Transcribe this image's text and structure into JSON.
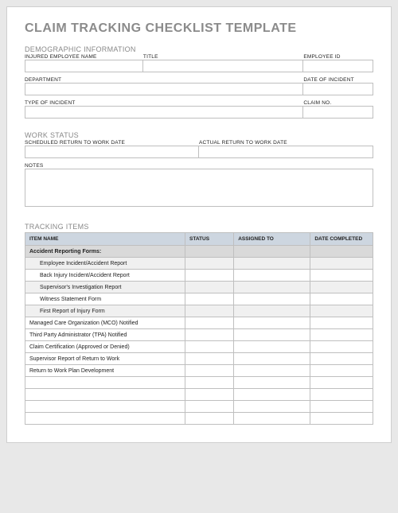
{
  "title": "CLAIM TRACKING CHECKLIST TEMPLATE",
  "sections": {
    "demographic": {
      "heading": "DEMOGRAPHIC INFORMATION",
      "labels": {
        "employee_name": "INJURED EMPLOYEE NAME",
        "title": "TITLE",
        "employee_id": "EMPLOYEE ID",
        "department": "DEPARTMENT",
        "date_of_incident": "DATE OF INCIDENT",
        "type_of_incident": "TYPE OF INCIDENT",
        "claim_no": "CLAIM NO."
      }
    },
    "work_status": {
      "heading": "WORK STATUS",
      "labels": {
        "scheduled_return": "SCHEDULED RETURN TO WORK DATE",
        "actual_return": "ACTUAL RETURN TO WORK DATE",
        "notes": "NOTES"
      }
    },
    "tracking": {
      "heading": "TRACKING ITEMS",
      "columns": {
        "item": "ITEM NAME",
        "status": "STATUS",
        "assigned": "ASSIGNED TO",
        "date": "DATE COMPLETED"
      },
      "rows": [
        {
          "type": "subhead",
          "item": "Accident Reporting Forms:"
        },
        {
          "type": "indent",
          "zebra": true,
          "item": "Employee Incident/Accident Report"
        },
        {
          "type": "indent",
          "zebra": false,
          "item": "Back Injury Incident/Accident Report"
        },
        {
          "type": "indent",
          "zebra": true,
          "item": "Supervisor's Investigation Report"
        },
        {
          "type": "indent",
          "zebra": false,
          "item": "Witness Statement Form"
        },
        {
          "type": "indent",
          "zebra": true,
          "item": "First Report of Injury Form"
        },
        {
          "type": "normal",
          "item": "Managed Care Organization (MCO) Notified"
        },
        {
          "type": "normal",
          "item": "Third Party Administrator (TPA) Notified"
        },
        {
          "type": "normal",
          "item": "Claim Certification (Approved or Denied)"
        },
        {
          "type": "normal",
          "item": "Supervisor Report of Return to Work"
        },
        {
          "type": "normal",
          "item": "Return to Work Plan Development"
        },
        {
          "type": "blank"
        },
        {
          "type": "blank"
        },
        {
          "type": "blank"
        },
        {
          "type": "blank"
        }
      ]
    }
  }
}
